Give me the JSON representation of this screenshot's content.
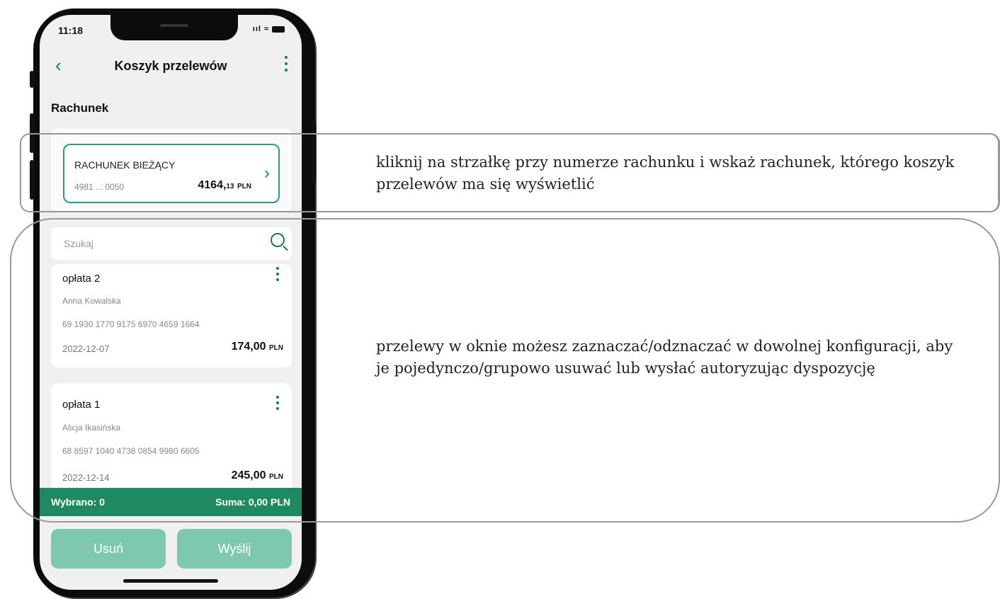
{
  "status": {
    "time": "11:18",
    "signal": "ııl",
    "wifi": "≈"
  },
  "header": {
    "back": "‹",
    "title": "Koszyk przelewów"
  },
  "section_label": "Rachunek",
  "account": {
    "name": "RACHUNEK BIEŻĄCY",
    "number": "4981 ... 0050",
    "amount": "4164,",
    "amount_dec": "13",
    "currency": "PLN",
    "arrow": "›"
  },
  "search": {
    "placeholder": "Szukaj"
  },
  "transfers": [
    {
      "name": "opłata 2",
      "person": "Anna Kowalska",
      "account": "69 1930 1770 9175 6970 4659 1664",
      "date": "2022-12-07",
      "amount": "174,00",
      "currency": "PLN"
    },
    {
      "name": "opłata 1",
      "person": "Alicja Ikasińska",
      "account": "68 8597 1040 4738 0854 9980 6605",
      "date": "2022-12-14",
      "amount": "245,00",
      "currency": "PLN"
    }
  ],
  "footer": {
    "selected": "Wybrano: 0",
    "sum": "Suma: 0,00 PLN"
  },
  "actions": {
    "delete": "Usuń",
    "send": "Wyślij"
  },
  "annotations": {
    "account_hint": "kliknij na strzałkę przy numerze rachunku i wskaż rachunek, którego koszyk przelewów ma się wyświetlić",
    "transfers_hint": "przelewy w oknie możesz zaznaczać/odznaczać w dowolnej konfiguracji, aby je pojedynczo/grupowo usuwać lub wysłać autoryzując dyspozycję"
  },
  "colors": {
    "accent": "#1f8a62",
    "button_disabled": "#7ec9ae",
    "callout_border": "#999999"
  }
}
